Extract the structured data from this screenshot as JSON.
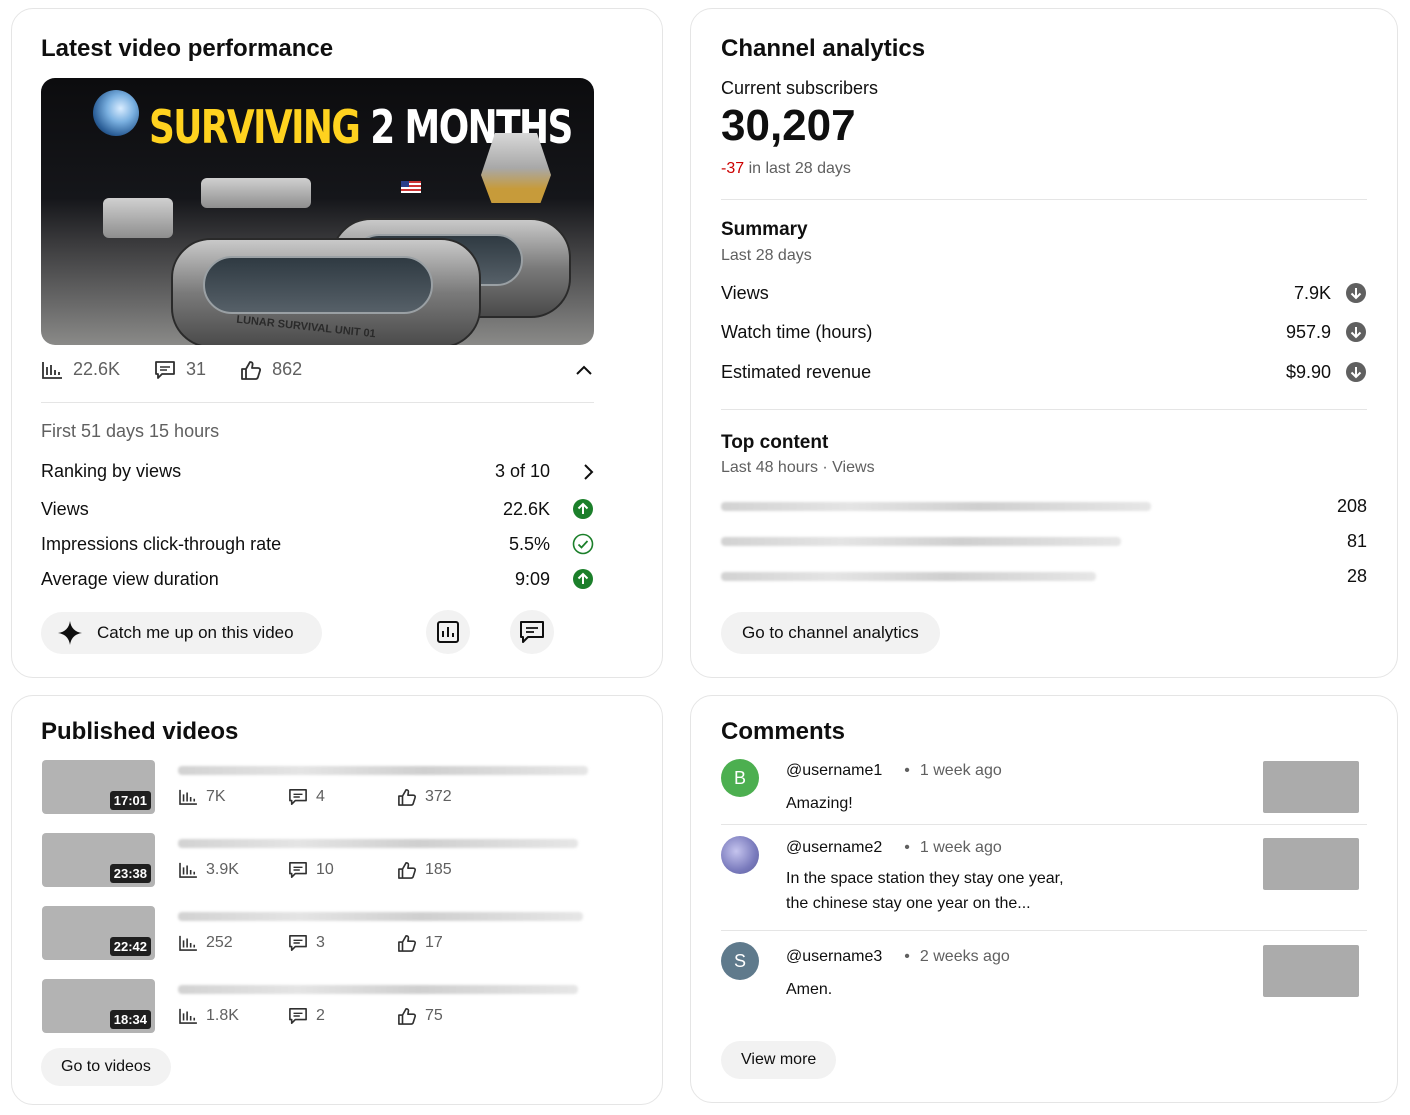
{
  "latest": {
    "title": "Latest video performance",
    "thumbnail_text_1": "SURVIVING",
    "thumbnail_text_2": "2 MONTHS",
    "thumbnail_label": "LUNAR SURVIVAL UNIT 01",
    "views": "22.6K",
    "comments": "31",
    "likes": "862",
    "period": "First 51 days 15 hours",
    "metrics": [
      {
        "label": "Ranking by views",
        "value": "3 of 10",
        "icon": "chevron-right-icon"
      },
      {
        "label": "Views",
        "value": "22.6K",
        "icon": "arrow-up-circle-icon"
      },
      {
        "label": "Impressions click-through rate",
        "value": "5.5%",
        "icon": "check-circle-icon"
      },
      {
        "label": "Average view duration",
        "value": "9:09",
        "icon": "arrow-up-circle-icon"
      }
    ],
    "catch_up_label": "Catch me up on this video"
  },
  "channel": {
    "title": "Channel analytics",
    "subs_label": "Current subscribers",
    "subs_value": "30,207",
    "subs_change": "-37",
    "subs_change_suffix": "in last 28 days",
    "summary_title": "Summary",
    "summary_period": "Last 28 days",
    "summary": [
      {
        "label": "Views",
        "value": "7.9K"
      },
      {
        "label": "Watch time (hours)",
        "value": "957.9"
      },
      {
        "label": "Estimated revenue",
        "value": "$9.90"
      }
    ],
    "top_title": "Top content",
    "top_period": "Last 48 hours · Views",
    "top": [
      {
        "value": "208"
      },
      {
        "value": "81"
      },
      {
        "value": "28"
      }
    ],
    "go_label": "Go to channel analytics"
  },
  "published": {
    "title": "Published videos",
    "videos": [
      {
        "duration": "17:01",
        "views": "7K",
        "comments": "4",
        "likes": "372"
      },
      {
        "duration": "23:38",
        "views": "3.9K",
        "comments": "10",
        "likes": "185"
      },
      {
        "duration": "22:42",
        "views": "252",
        "comments": "3",
        "likes": "17"
      },
      {
        "duration": "18:34",
        "views": "1.8K",
        "comments": "2",
        "likes": "75"
      }
    ],
    "go_label": "Go to videos"
  },
  "comments": {
    "title": "Comments",
    "items": [
      {
        "initial": "B",
        "user": "@username1",
        "time": "1 week ago",
        "text": "Amazing!",
        "text2": "",
        "avatar_color": "#4caf50"
      },
      {
        "initial": "",
        "user": "@username2",
        "time": "1 week ago",
        "text": "In the space station they stay one year,",
        "text2": "the chinese stay one year on the...",
        "avatar_color": "#8e90c8"
      },
      {
        "initial": "S",
        "user": "@username3",
        "time": "2 weeks ago",
        "text": "Amen.",
        "text2": "",
        "avatar_color": "#5f7a8c"
      }
    ],
    "view_more_label": "View more"
  },
  "colors": {
    "accent_green": "#1b7f2a",
    "negative_red": "#cc0000",
    "down_icon": "#606060"
  }
}
